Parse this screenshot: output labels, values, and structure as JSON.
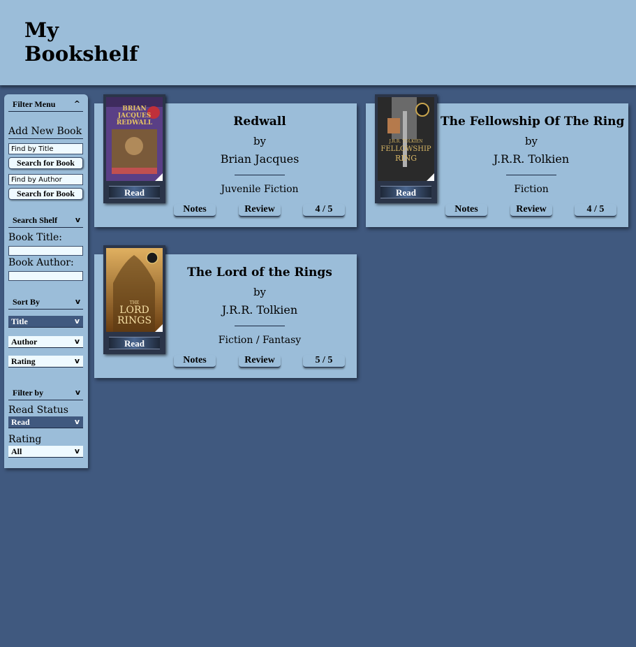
{
  "app": {
    "title": "My Bookshelf"
  },
  "sidebar": {
    "filter_menu": {
      "label": "Filter Menu",
      "chevron": "^"
    },
    "add_new_book": {
      "heading": "Add New Book",
      "title_placeholder": "Find by Title",
      "search_title_button": "Search for Book",
      "author_placeholder": "Find by Author",
      "search_author_button": "Search for Book"
    },
    "search_shelf": {
      "label": "Search Shelf",
      "chevron": "v",
      "book_title_label": "Book Title:",
      "book_title_value": "",
      "book_author_label": "Book Author:",
      "book_author_value": ""
    },
    "sort_by": {
      "label": "Sort By",
      "chevron": "v",
      "options": [
        {
          "label": "Title",
          "chevron": "v",
          "active": true
        },
        {
          "label": "Author",
          "chevron": "v",
          "active": false
        },
        {
          "label": "Rating",
          "chevron": "v",
          "active": false
        }
      ]
    },
    "filter_by": {
      "label": "Filter by",
      "chevron": "v",
      "read_status_label": "Read Status",
      "read_status_value": "Read",
      "read_status_chevron": "v",
      "rating_label": "Rating",
      "rating_value": "All",
      "rating_chevron": "v"
    }
  },
  "books": [
    {
      "title": "Redwall",
      "by": "by",
      "author": "Brian Jacques",
      "genre": "Juvenile Fiction",
      "read_label": "Read",
      "notes_label": "Notes",
      "review_label": "Review",
      "rating": "4 / 5",
      "cover": {
        "line1": "BRIAN",
        "line2": "JACQUES",
        "line3": "REDWALL",
        "bg": "#5a3f86",
        "accent": "#c7a24a"
      }
    },
    {
      "title": "The Fellowship Of The Ring",
      "by": "by",
      "author": "J.R.R. Tolkien",
      "genre": "Fiction",
      "read_label": "Read",
      "notes_label": "Notes",
      "review_label": "Review",
      "rating": "4 / 5",
      "cover": {
        "line1": "J.R.R. TOLKIEN",
        "line2": "FELLOWSHIP",
        "line3": "RING",
        "bg": "#2a2a2a",
        "accent": "#c9a54e"
      }
    },
    {
      "title": "The Lord of the Rings",
      "by": "by",
      "author": "J.R.R. Tolkien",
      "genre": "Fiction / Fantasy",
      "read_label": "Read",
      "notes_label": "Notes",
      "review_label": "Review",
      "rating": "5 / 5",
      "cover": {
        "line1": "THE",
        "line2": "LORD",
        "line3": "RINGS",
        "bg": "#8a5a1e",
        "accent": "#f0d28a"
      }
    }
  ],
  "colors": {
    "page_bg": "#40597f",
    "panel": "#9bbdd9",
    "input_bg": "#effaff"
  }
}
